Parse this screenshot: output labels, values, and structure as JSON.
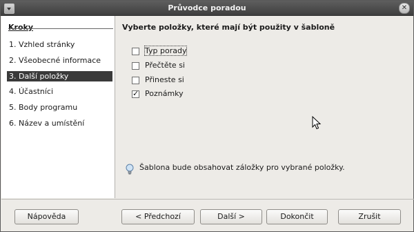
{
  "window": {
    "title": "Průvodce poradou"
  },
  "sidebar": {
    "title": "Kroky",
    "steps": [
      "1. Vzhled stránky",
      "2. Všeobecné informace",
      "3. Další položky",
      "4. Účastníci",
      "5. Body programu",
      "6. Název a umístění"
    ],
    "active_step_index": 2
  },
  "main": {
    "heading": "Vyberte položky, které mají být použity v šabloně",
    "options": [
      {
        "label": "Typ porady",
        "checked": false
      },
      {
        "label": "Přečtěte si",
        "checked": false
      },
      {
        "label": "Přineste si",
        "checked": false
      },
      {
        "label": "Poznámky",
        "checked": true
      }
    ],
    "hint": "Šablona bude obsahovat záložky pro vybrané položky."
  },
  "buttons": {
    "help": "Nápověda",
    "back": "< Předchozí",
    "next": "Další >",
    "finish": "Dokončit",
    "cancel": "Zrušit"
  },
  "icons": {
    "window_menu": "chevron-down-icon",
    "window_close": "close-icon",
    "hint": "lightbulb-icon",
    "pointer": "mouse-cursor"
  }
}
